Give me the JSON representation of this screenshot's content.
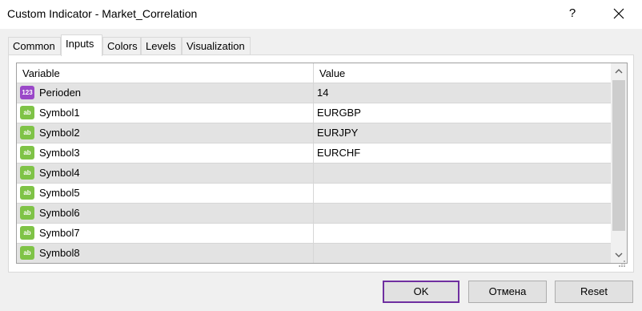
{
  "window": {
    "title": "Custom Indicator - Market_Correlation",
    "help_label": "?"
  },
  "tabs": [
    {
      "label": "Common"
    },
    {
      "label": "Inputs"
    },
    {
      "label": "Colors"
    },
    {
      "label": "Levels"
    },
    {
      "label": "Visualization"
    }
  ],
  "active_tab": "Inputs",
  "grid": {
    "headers": {
      "variable": "Variable",
      "value": "Value"
    },
    "rows": [
      {
        "variable": "Perioden",
        "value": "14",
        "type_icon": "123",
        "type_name": "integer-icon"
      },
      {
        "variable": "Symbol1",
        "value": "EURGBP",
        "type_icon": "ab",
        "type_name": "string-icon"
      },
      {
        "variable": "Symbol2",
        "value": "EURJPY",
        "type_icon": "ab",
        "type_name": "string-icon"
      },
      {
        "variable": "Symbol3",
        "value": "EURCHF",
        "type_icon": "ab",
        "type_name": "string-icon"
      },
      {
        "variable": "Symbol4",
        "value": "",
        "type_icon": "ab",
        "type_name": "string-icon"
      },
      {
        "variable": "Symbol5",
        "value": "",
        "type_icon": "ab",
        "type_name": "string-icon"
      },
      {
        "variable": "Symbol6",
        "value": "",
        "type_icon": "ab",
        "type_name": "string-icon"
      },
      {
        "variable": "Symbol7",
        "value": "",
        "type_icon": "ab",
        "type_name": "string-icon"
      },
      {
        "variable": "Symbol8",
        "value": "",
        "type_icon": "ab",
        "type_name": "string-icon"
      }
    ]
  },
  "buttons": {
    "ok": "OK",
    "cancel": "Отмена",
    "reset": "Reset"
  },
  "colors": {
    "ok_border": "#6f2fa0",
    "int_icon": "#9a48c8",
    "str_icon": "#7fc347"
  }
}
